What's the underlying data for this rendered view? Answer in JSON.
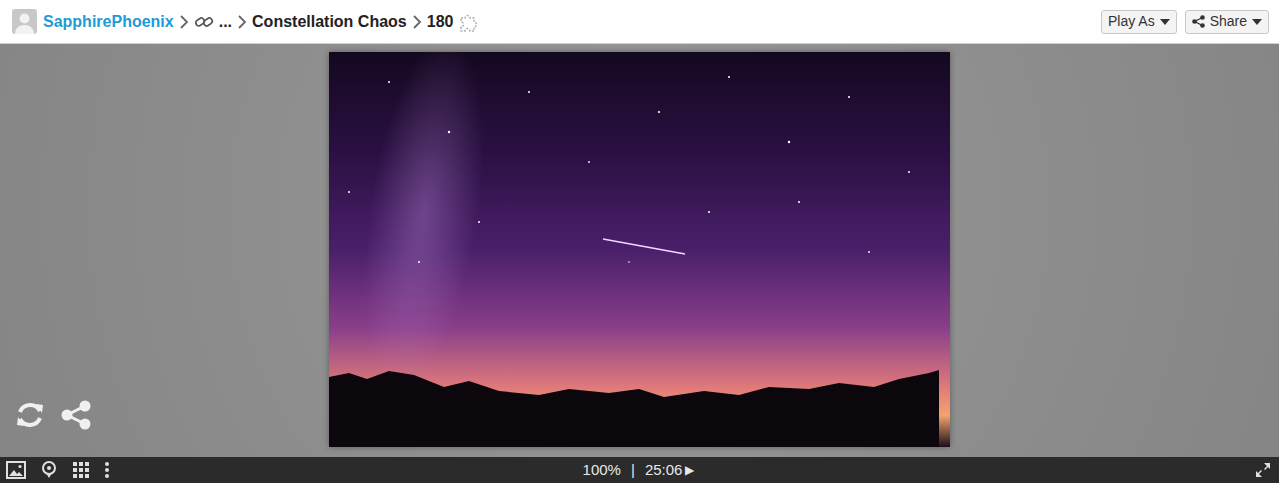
{
  "breadcrumb": {
    "user": "SapphirePhoenix",
    "ellipsis": "...",
    "collection": "Constellation Chaos",
    "puzzle": "180"
  },
  "buttons": [
    {
      "label": "Play As"
    },
    {
      "label": "Share"
    }
  ],
  "status_bar": {
    "zoom": "100%",
    "separator": "|",
    "timer": "25:06",
    "play": "▶"
  }
}
